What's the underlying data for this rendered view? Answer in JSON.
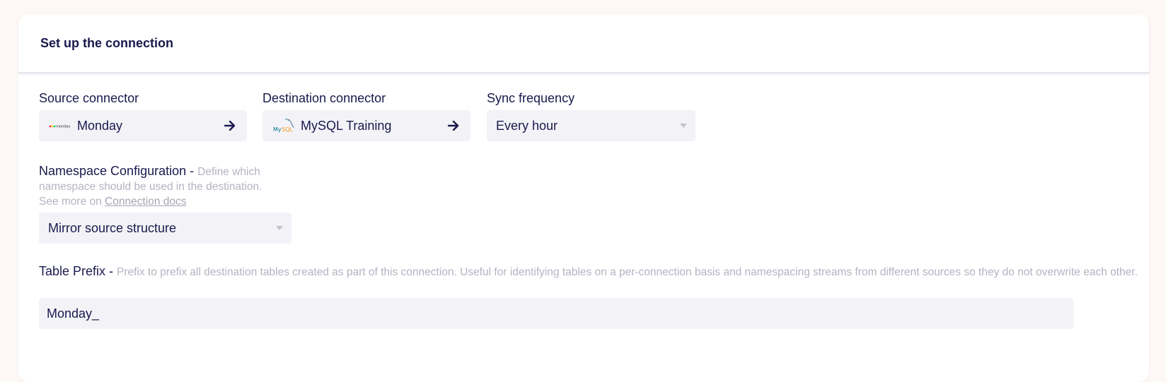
{
  "card": {
    "title": "Set up the connection"
  },
  "source": {
    "label": "Source connector",
    "name": "Monday",
    "icon": "monday-logo",
    "action_icon": "arrow-right-icon"
  },
  "destination": {
    "label": "Destination connector",
    "name": "MySQL Training",
    "icon": "mysql-logo",
    "action_icon": "arrow-right-icon"
  },
  "sync": {
    "label": "Sync frequency",
    "value": "Every hour"
  },
  "namespace": {
    "label": "Namespace Configuration - ",
    "help": "Define which namespace should be used in the destination.",
    "see_more": "See more on ",
    "docs_link": "Connection docs",
    "value": "Mirror source structure"
  },
  "prefix": {
    "label": "Table Prefix - ",
    "help": "Prefix to prefix all destination tables created as part of this connection. Useful for identifying tables on a per-connection basis and namespacing streams from different sources so they do not overwrite each other.",
    "value": "Monday_"
  },
  "colors": {
    "text": "#1a194d",
    "muted": "#b4b3c2",
    "field_bg": "#f3f3f7",
    "page_bg": "#fdf8f5"
  }
}
